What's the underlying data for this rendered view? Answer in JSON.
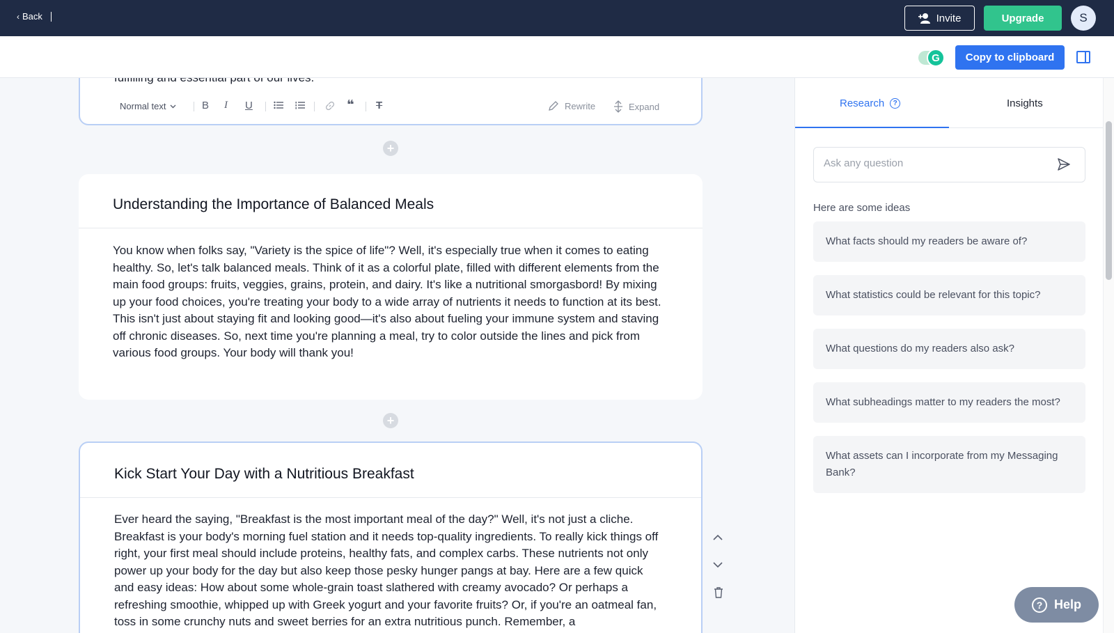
{
  "topbar": {
    "back_label": "Back",
    "invite_label": "Invite",
    "upgrade_label": "Upgrade",
    "avatar_initial": "S"
  },
  "subbar": {
    "grammarly_letter": "G",
    "copy_label": "Copy to clipboard"
  },
  "editor": {
    "block1_partial_text": "fulfilling and essential part of our lives.",
    "toolbar": {
      "format_label": "Normal text",
      "rewrite_label": "Rewrite",
      "expand_label": "Expand"
    },
    "block2": {
      "title": "Understanding the Importance of Balanced Meals",
      "body": "You know when folks say, \"Variety is the spice of life\"? Well, it's especially true when it comes to eating healthy. So, let's talk balanced meals. Think of it as a colorful plate, filled with different elements from the main food groups: fruits, veggies, grains, protein, and dairy. It's like a nutritional smorgasbord! By mixing up your food choices, you're treating your body to a wide array of nutrients it needs to function at its best. This isn't just about staying fit and looking good—it's also about fueling your immune system and staving off chronic diseases. So, next time you're planning a meal, try to color outside the lines and pick from various food groups. Your body will thank you!"
    },
    "block3": {
      "title": "Kick Start Your Day with a Nutritious Breakfast",
      "body": "Ever heard the saying, \"Breakfast is the most important meal of the day?\" Well, it's not just a cliche. Breakfast is your body's morning fuel station and it needs top-quality ingredients. To really kick things off right, your first meal should include proteins, healthy fats, and complex carbs. These nutrients not only power up your body for the day but also keep those pesky hunger pangs at bay. Here are a few quick and easy ideas: How about some whole-grain toast slathered with creamy avocado? Or perhaps a refreshing smoothie, whipped up with Greek yogurt and your favorite fruits? Or, if you're an oatmeal fan, toss in some crunchy nuts and sweet berries for an extra nutritious punch. Remember, a"
    }
  },
  "panel": {
    "tab_research": "Research",
    "tab_insights": "Insights",
    "ask_placeholder": "Ask any question",
    "ideas_label": "Here are some ideas",
    "ideas": [
      "What facts should my readers be aware of?",
      "What statistics could be relevant for this topic?",
      "What questions do my readers also ask?",
      "What subheadings matter to my readers the most?",
      "What assets can I incorporate from my Messaging Bank?"
    ]
  },
  "help_label": "Help",
  "colors": {
    "topbar": "#1f2b45",
    "accent": "#2f73f0",
    "upgrade": "#31c48d"
  }
}
